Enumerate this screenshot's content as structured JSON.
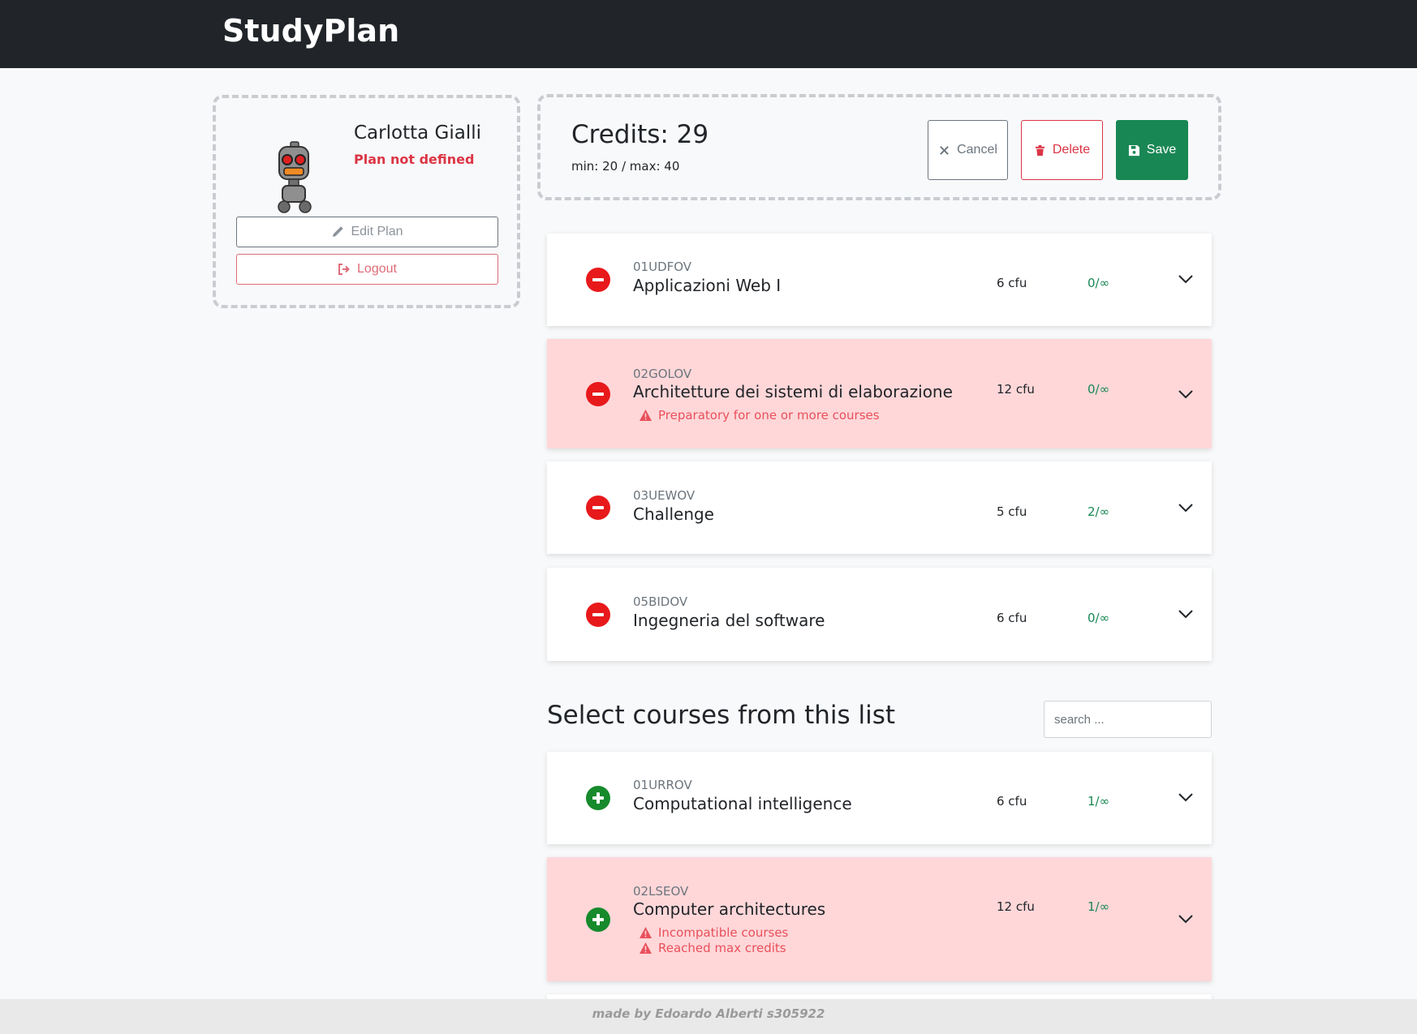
{
  "navbar": {
    "brand": "StudyPlan"
  },
  "user": {
    "name": "Carlotta Gialli",
    "plan_status": "Plan not defined",
    "edit_label": "Edit Plan",
    "logout_label": "Logout",
    "avatar_icon": "robot-avatar-icon"
  },
  "credits": {
    "title": "Credits: 29",
    "minmax": "min: 20 / max: 40",
    "cancel_label": "Cancel",
    "delete_label": "Delete",
    "save_label": "Save"
  },
  "plan_courses": [
    {
      "code": "01UDFOV",
      "name": "Applicazioni Web I",
      "cfu": "6 cfu",
      "enrolled": "0/∞",
      "warnings": []
    },
    {
      "code": "02GOLOV",
      "name": "Architetture dei sistemi di elaborazione",
      "cfu": "12 cfu",
      "enrolled": "0/∞",
      "warnings": [
        "Preparatory for one or more courses"
      ]
    },
    {
      "code": "03UEWOV",
      "name": "Challenge",
      "cfu": "5 cfu",
      "enrolled": "2/∞",
      "warnings": []
    },
    {
      "code": "05BIDOV",
      "name": "Ingegneria del software",
      "cfu": "6 cfu",
      "enrolled": "0/∞",
      "warnings": []
    }
  ],
  "catalog": {
    "title": "Select courses from this list",
    "search_placeholder": "search ...",
    "courses": [
      {
        "code": "01URROV",
        "name": "Computational intelligence",
        "cfu": "6 cfu",
        "enrolled": "1/∞",
        "warnings": []
      },
      {
        "code": "02LSEOV",
        "name": "Computer architectures",
        "cfu": "12 cfu",
        "enrolled": "1/∞",
        "warnings": [
          "Incompatible courses",
          "Reached max credits"
        ]
      }
    ]
  },
  "footer": {
    "text": "made by Edoardo Alberti s305922"
  },
  "colors": {
    "navbar": "#212529",
    "danger": "#dc3545",
    "success": "#198754",
    "warning_row": "#ffd7d9"
  }
}
